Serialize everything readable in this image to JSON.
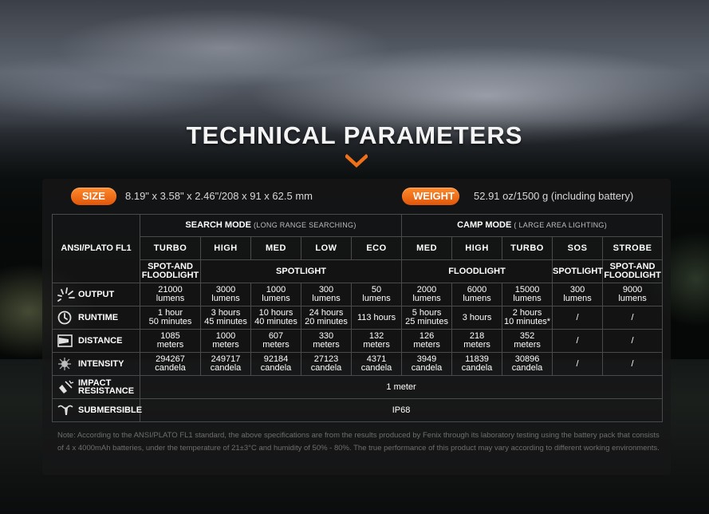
{
  "title": "TECHNICAL PARAMETERS",
  "size": {
    "label": "SIZE",
    "value": "8.19\" x 3.58\" x 2.46\"/208 x 91 x 62.5 mm"
  },
  "weight": {
    "label": "WEIGHT",
    "value": "52.91 oz/1500 g (including battery)"
  },
  "table": {
    "model": "ANSI/PLATO FL1",
    "search_mode": {
      "label": "SEARCH MODE",
      "sub": "(LONG RANGE SEARCHING)"
    },
    "camp_mode": {
      "label": "CAMP MODE",
      "sub": "( LARGE AREA LIGHTING)"
    },
    "modes": [
      "TURBO",
      "HIGH",
      "MED",
      "LOW",
      "ECO",
      "MED",
      "HIGH",
      "TURBO",
      "SOS",
      "STROBE"
    ],
    "beam_types": {
      "spot_flood_1": "SPOT-AND FLOODLIGHT",
      "spotlight_search": "SPOTLIGHT",
      "floodlight": "FLOODLIGHT",
      "spotlight_sos": "SPOTLIGHT",
      "spot_flood_2": "SPOT-AND FLOODLIGHT"
    },
    "rows": {
      "output": {
        "label": "OUTPUT",
        "icon": "light-burst-icon",
        "values": [
          [
            "21000",
            "lumens"
          ],
          [
            "3000",
            "lumens"
          ],
          [
            "1000",
            "lumens"
          ],
          [
            "300",
            "lumens"
          ],
          [
            "50",
            "lumens"
          ],
          [
            "2000",
            "lumens"
          ],
          [
            "6000",
            "lumens"
          ],
          [
            "15000",
            "lumens"
          ],
          [
            "300",
            "lumens"
          ],
          [
            "9000",
            "lumens"
          ]
        ]
      },
      "runtime": {
        "label": "RUNTIME",
        "icon": "clock-icon",
        "values": [
          [
            "1 hour",
            "50 minutes"
          ],
          [
            "3 hours",
            "45 minutes"
          ],
          [
            "10 hours",
            "40 minutes"
          ],
          [
            "24 hours",
            "20 minutes"
          ],
          [
            "113 hours",
            ""
          ],
          [
            "5 hours",
            "25 minutes"
          ],
          [
            "3 hours",
            ""
          ],
          [
            "2 hours",
            "10 minutes*"
          ],
          [
            "/",
            ""
          ],
          [
            "/",
            ""
          ]
        ]
      },
      "distance": {
        "label": "DISTANCE",
        "icon": "distance-icon",
        "values": [
          [
            "1085",
            "meters"
          ],
          [
            "1000",
            "meters"
          ],
          [
            "607",
            "meters"
          ],
          [
            "330",
            "meters"
          ],
          [
            "132",
            "meters"
          ],
          [
            "126",
            "meters"
          ],
          [
            "218",
            "meters"
          ],
          [
            "352",
            "meters"
          ],
          [
            "/",
            ""
          ],
          [
            "/",
            ""
          ]
        ]
      },
      "intensity": {
        "label": "INTENSITY",
        "icon": "intensity-icon",
        "values": [
          [
            "294267",
            "candela"
          ],
          [
            "249717",
            "candela"
          ],
          [
            "92184",
            "candela"
          ],
          [
            "27123",
            "candela"
          ],
          [
            "4371",
            "candela"
          ],
          [
            "3949",
            "candela"
          ],
          [
            "11839",
            "candela"
          ],
          [
            "30896",
            "candela"
          ],
          [
            "/",
            ""
          ],
          [
            "/",
            ""
          ]
        ]
      },
      "impact": {
        "label1": "IMPACT",
        "label2": "RESISTANCE",
        "icon": "impact-icon",
        "value": "1 meter"
      },
      "submersible": {
        "label": "SUBMERSIBLE",
        "icon": "submersible-icon",
        "value": "IP68"
      }
    }
  },
  "note": "Note: According to the ANSI/PLATO FL1 standard, the above specifications are from the results produced by Fenix through its laboratory testing using the battery pack that consists of 4 x 4000mAh batteries, under the temperature of 21±3°C and humidity of 50% - 80%. The true performance of this product may vary according to different working environments.",
  "colors": {
    "accent": "#f0701a",
    "panel": "#161718",
    "border": "#4a4a4a"
  }
}
